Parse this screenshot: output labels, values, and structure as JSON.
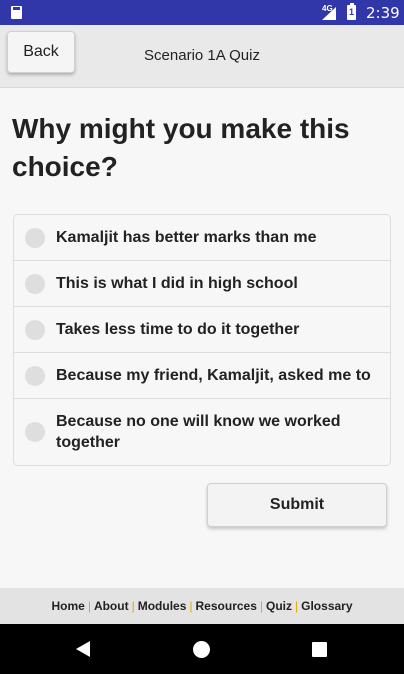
{
  "status_bar": {
    "network": "4G",
    "battery_level": "1",
    "time": "2:39"
  },
  "header": {
    "back_label": "Back",
    "title": "Scenario 1A Quiz"
  },
  "question": "Why might you make this choice?",
  "options": [
    "Kamaljit has better marks than me",
    "This is what I did in high school",
    "Takes less time to do it together",
    "Because my friend, Kamaljit, asked me to",
    "Because no one will know we worked together"
  ],
  "submit_label": "Submit",
  "footer": {
    "links": [
      "Home",
      "About",
      "Modules",
      "Resources",
      "Quiz",
      "Glossary"
    ],
    "separator": "|"
  },
  "icons": {
    "sd_card": "sd-card-icon",
    "signal": "signal-icon",
    "battery": "battery-icon",
    "nav_back": "back-triangle-icon",
    "nav_home": "home-circle-icon",
    "nav_recent": "recent-apps-icon"
  },
  "colors": {
    "status_bar": "#3137a8",
    "footer_separator": "#e0a800"
  }
}
